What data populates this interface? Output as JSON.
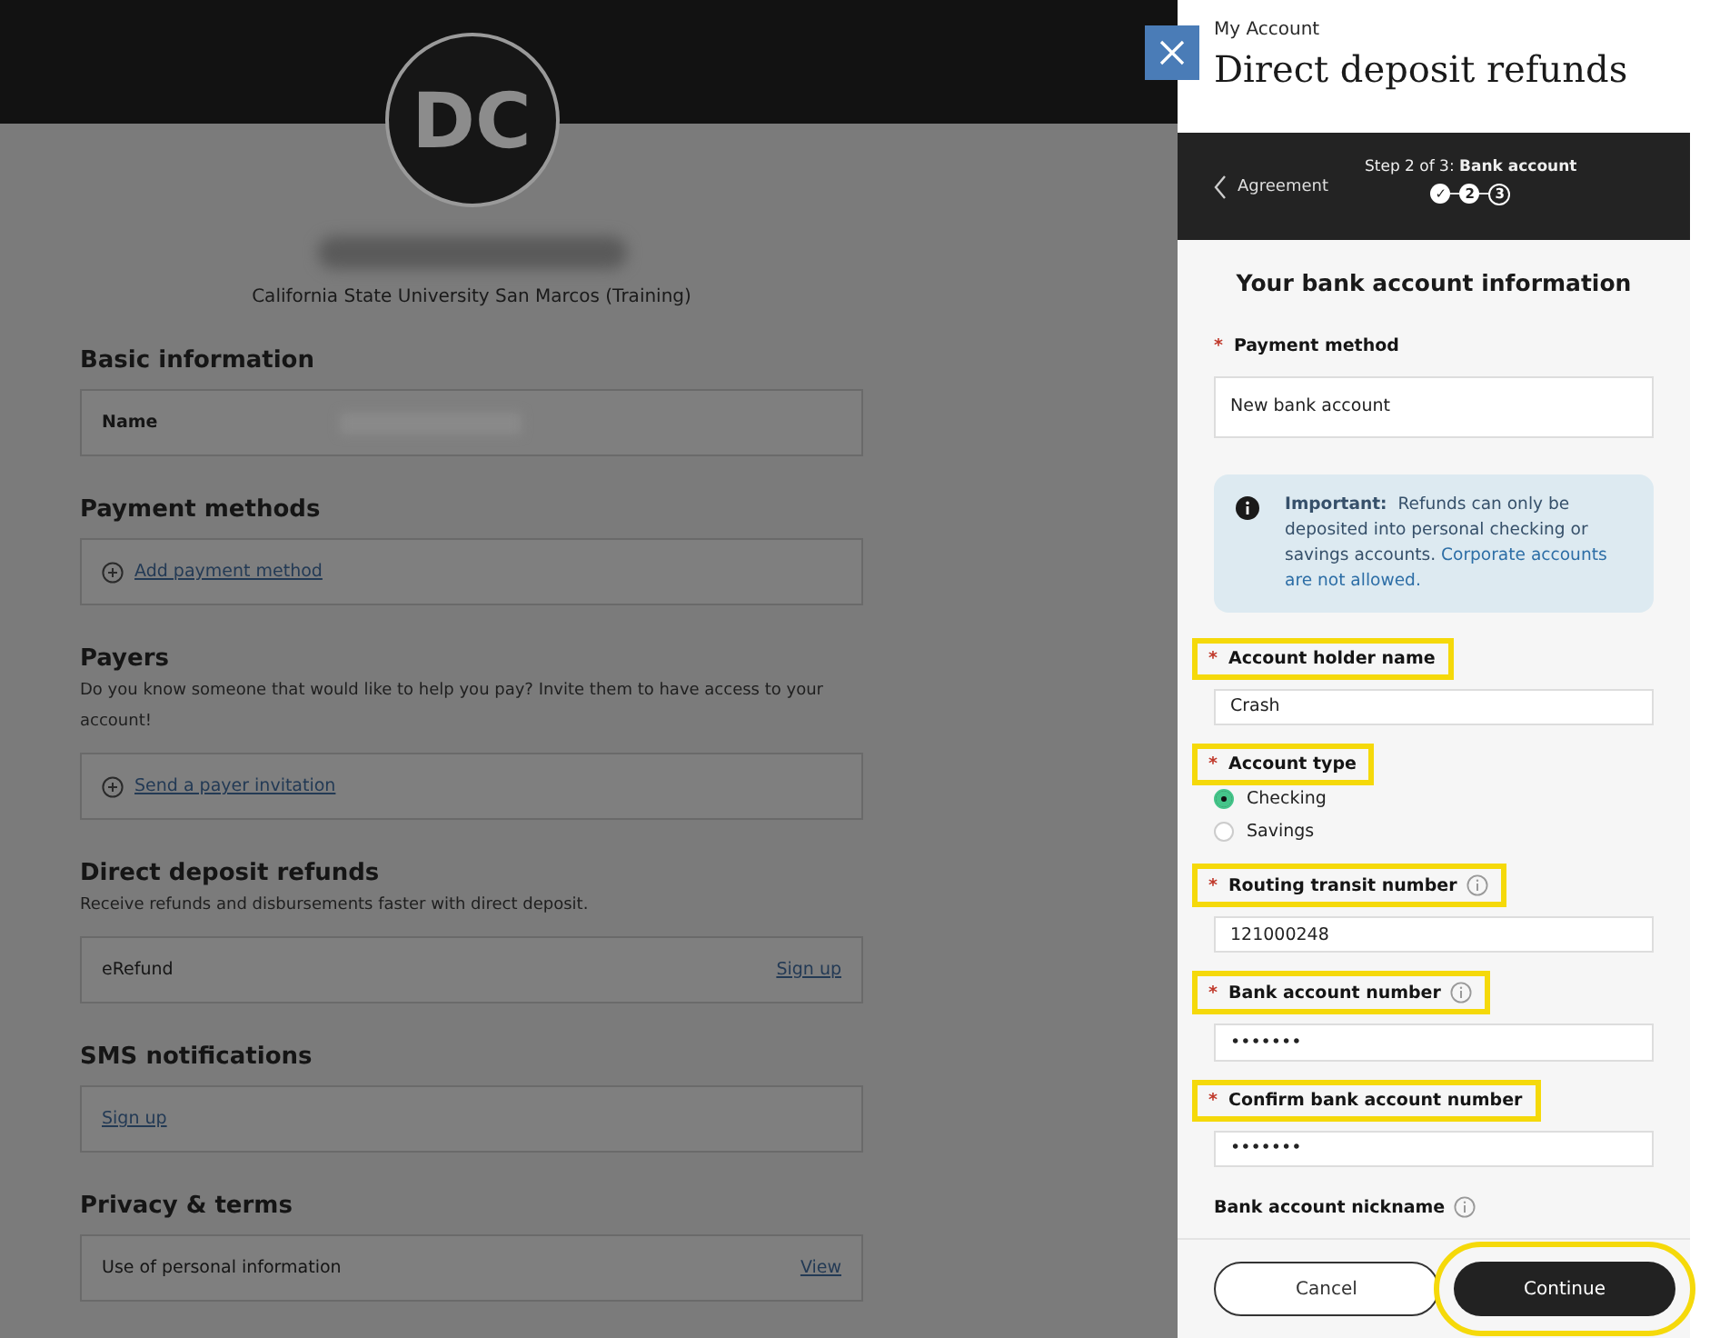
{
  "profile": {
    "initials": "DC",
    "institution": "California State University San Marcos (Training)"
  },
  "sections": [
    {
      "title": "Basic information",
      "rows": [
        {
          "kind": "field",
          "label": "Name"
        }
      ]
    },
    {
      "title": "Payment methods",
      "rows": [
        {
          "kind": "add",
          "link": "Add payment method"
        }
      ]
    },
    {
      "title": "Payers",
      "description": "Do you know someone that would like to help you pay? Invite them to have access to your account!",
      "rows": [
        {
          "kind": "add",
          "link": "Send a payer invitation"
        }
      ]
    },
    {
      "title": "Direct deposit refunds",
      "description": "Receive refunds and disbursements faster with direct deposit.",
      "rows": [
        {
          "kind": "action",
          "label": "eRefund",
          "link": "Sign up"
        }
      ]
    },
    {
      "title": "SMS notifications",
      "rows": [
        {
          "kind": "link",
          "link": "Sign up"
        }
      ]
    },
    {
      "title": "Privacy & terms",
      "rows": [
        {
          "kind": "action",
          "label": "Use of personal information",
          "link": "View"
        }
      ]
    }
  ],
  "panel": {
    "breadcrumb": "My Account",
    "title": "Direct deposit refunds",
    "back": "Agreement",
    "step_label": "Step 2 of 3: ",
    "step_name": "Bank account",
    "steps": [
      {
        "label": "✓",
        "kind": "done"
      },
      {
        "label": "2",
        "kind": "current"
      },
      {
        "label": "3",
        "kind": "todo"
      }
    ],
    "heading": "Your bank account information",
    "fields": [
      {
        "kind": "select",
        "label": "Payment method",
        "required": "*",
        "info": false,
        "highlighted": false,
        "value": "New bank account"
      },
      {
        "kind": "notice",
        "lead": "Important:",
        "text": "Refunds can only be deposited into personal checking or savings accounts.",
        "link": "Corporate accounts are not allowed."
      },
      {
        "kind": "text",
        "label": "Account holder name",
        "required": "*",
        "info": false,
        "highlighted": true,
        "value": "Crash"
      },
      {
        "kind": "radio",
        "label": "Account type",
        "required": "*",
        "info": false,
        "highlighted": true,
        "options": [
          {
            "label": "Checking",
            "selected": true
          },
          {
            "label": "Savings",
            "selected": false
          }
        ]
      },
      {
        "kind": "text",
        "label": "Routing transit number",
        "required": "*",
        "info": true,
        "highlighted": true,
        "value": "121000248"
      },
      {
        "kind": "text",
        "label": "Bank account number",
        "required": "*",
        "info": true,
        "highlighted": true,
        "value": "•••••••"
      },
      {
        "kind": "text",
        "label": "Confirm bank account number",
        "required": "*",
        "info": false,
        "highlighted": true,
        "value": "•••••••"
      },
      {
        "kind": "label",
        "label": "Bank account nickname",
        "info": true,
        "highlighted": false
      }
    ],
    "buttons": [
      {
        "label": "Cancel",
        "primary": false,
        "highlighted": false
      },
      {
        "label": "Continue",
        "primary": true,
        "highlighted": true
      }
    ]
  }
}
